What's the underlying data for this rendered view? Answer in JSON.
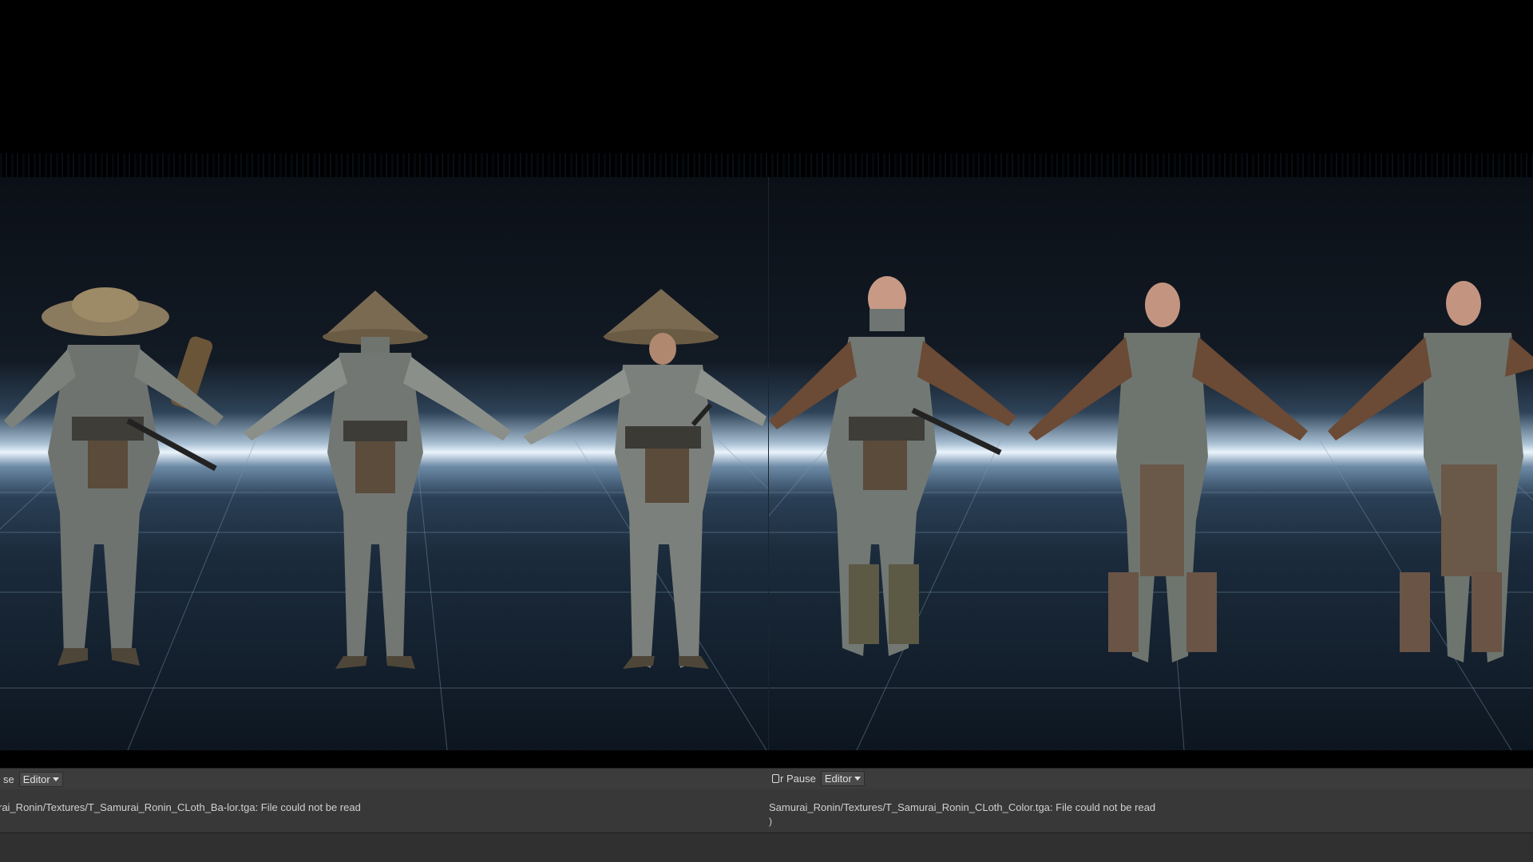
{
  "left_panel": {
    "toolbar_text": "se",
    "editor_dropdown": "Editor",
    "console_line": "rai_Ronin/Textures/T_Samurai_Ronin_CLoth_Ba-lor.tga: File could not be read"
  },
  "right_panel": {
    "pause_label": "r Pause",
    "editor_dropdown": "Editor",
    "console_line": "Samurai_Ronin/Textures/T_Samurai_Ronin_CLoth_Color.tga: File could not be read",
    "console_line2": ")"
  },
  "icons": [
    "caret-down-icon",
    "toggle-icon"
  ],
  "colors": {
    "toolbar_bg": "#3c3c3c",
    "console_bg": "#383838",
    "horizon_glow": "#eaf3fb",
    "sky_dark": "#0b1017"
  }
}
